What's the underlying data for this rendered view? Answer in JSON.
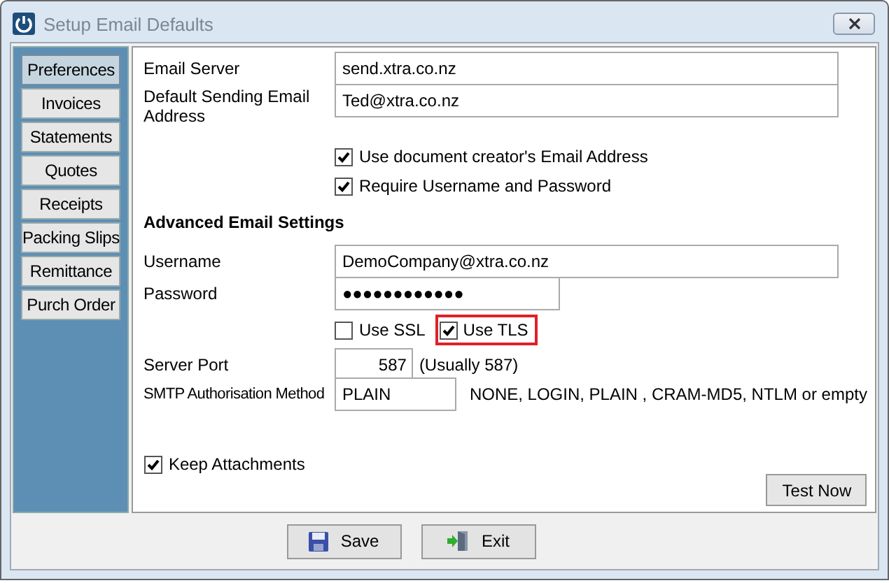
{
  "window": {
    "title": "Setup Email Defaults"
  },
  "sidebar": {
    "items": [
      {
        "label": "Preferences",
        "selected": true
      },
      {
        "label": "Invoices",
        "selected": false
      },
      {
        "label": "Statements",
        "selected": false
      },
      {
        "label": "Quotes",
        "selected": false
      },
      {
        "label": "Receipts",
        "selected": false
      },
      {
        "label": "Packing Slips",
        "selected": false
      },
      {
        "label": "Remittance",
        "selected": false
      },
      {
        "label": "Purch Order",
        "selected": false
      }
    ]
  },
  "fields": [
    {
      "label": "Email Server",
      "value": "send.xtra.co.nz"
    },
    {
      "label": "Default Sending Email Address",
      "value": "Ted@xtra.co.nz"
    }
  ],
  "options": [
    {
      "label": "Use document creator's Email Address",
      "checked": true
    },
    {
      "label": "Require Username and Password",
      "checked": true
    }
  ],
  "advanced": {
    "heading": "Advanced Email Settings",
    "username": {
      "label": "Username",
      "value": "DemoCompany@xtra.co.nz"
    },
    "password": {
      "label": "Password",
      "value": "●●●●●●●●●●●●"
    },
    "security": [
      {
        "label": "Use SSL",
        "checked": false,
        "highlighted": false
      },
      {
        "label": "Use TLS",
        "checked": true,
        "highlighted": true
      }
    ],
    "server_port": {
      "label": "Server Port",
      "value": "587",
      "hint": "(Usually 587)"
    },
    "auth_method": {
      "label": "SMTP Authorisation Method",
      "value": "PLAIN",
      "hint": "NONE,  LOGIN,  PLAIN ,  CRAM-MD5,  NTLM or empty"
    }
  },
  "keep_attachments": {
    "label": "Keep Attachments",
    "checked": true
  },
  "test_button": {
    "label": "Test Now"
  },
  "buttons": [
    {
      "label": "Save",
      "kind": "save"
    },
    {
      "label": "Exit",
      "kind": "exit"
    }
  ]
}
